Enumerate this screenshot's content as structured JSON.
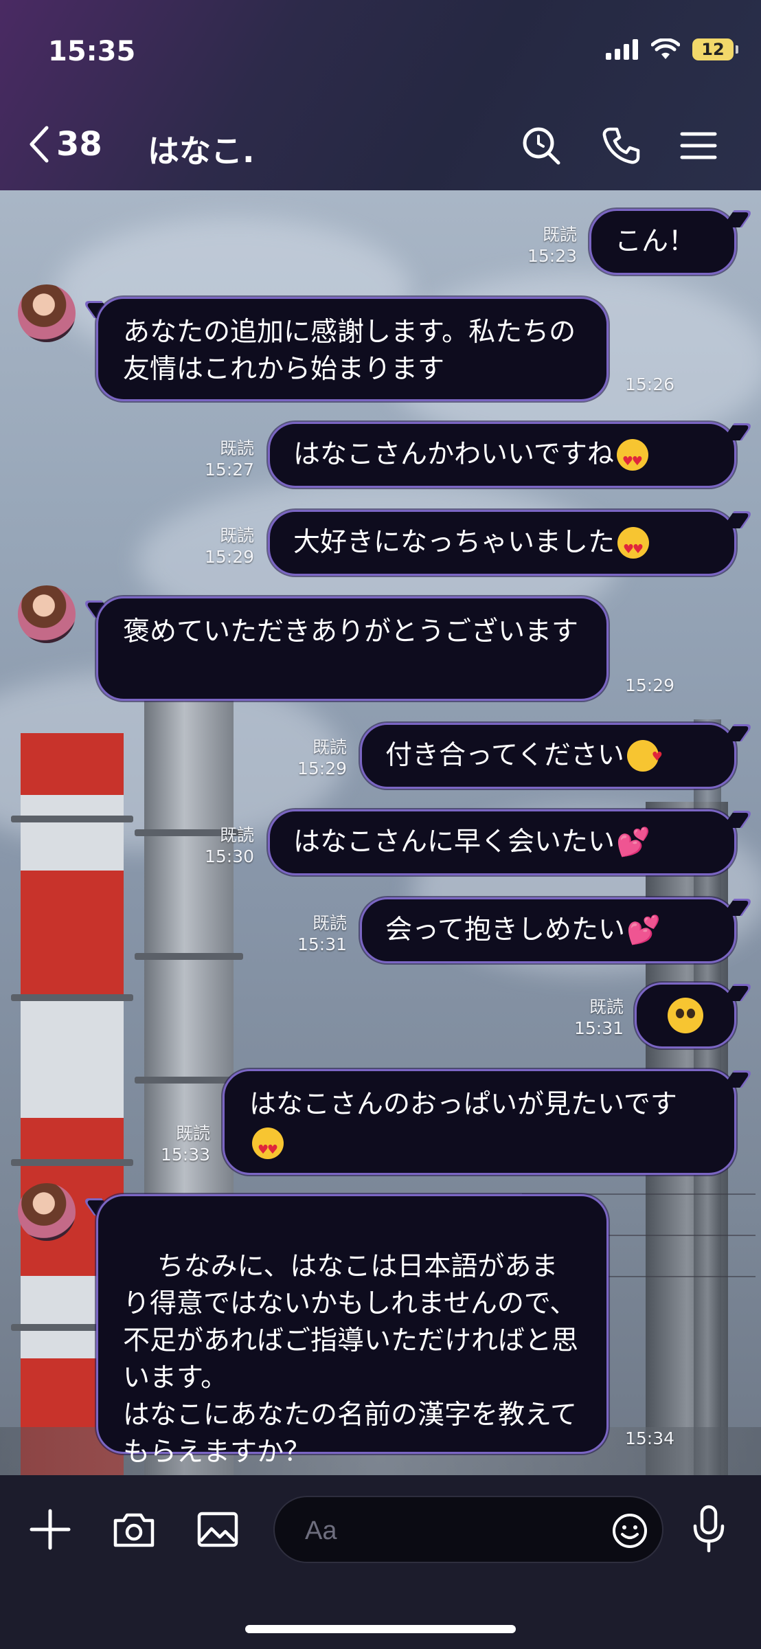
{
  "status_bar": {
    "time": "15:35",
    "battery": "12"
  },
  "header": {
    "back_count": "38",
    "title": "はなこ."
  },
  "read_label": "既読",
  "messages": [
    {
      "dir": "out",
      "text": "こん！",
      "time": "15:23",
      "read": true
    },
    {
      "dir": "in",
      "text": "あなたの追加に感謝します。私たちの友情はこれから始まります",
      "time": "15:26"
    },
    {
      "dir": "out",
      "text": "はなこさんかわいいですね",
      "emoji": "heart-eyes-emoji",
      "time": "15:27",
      "read": true
    },
    {
      "dir": "out",
      "text": "大好きになっちゃいました",
      "emoji": "heart-eyes-emoji",
      "time": "15:29",
      "read": true
    },
    {
      "dir": "in",
      "text": "褒めていただきありがとうございます",
      "time": "15:29"
    },
    {
      "dir": "out",
      "text": "付き合ってください",
      "emoji": "kissing-heart-emoji",
      "time": "15:29",
      "read": true
    },
    {
      "dir": "out",
      "text": "はなこさんに早く会いたい",
      "emoji": "two-hearts-emoji",
      "time": "15:30",
      "read": true
    },
    {
      "dir": "out",
      "text": "会って抱きしめたい",
      "emoji": "two-hearts-emoji",
      "time": "15:31",
      "read": true
    },
    {
      "dir": "out",
      "text": "",
      "emoji": "pleading-face-emoji",
      "time": "15:31",
      "read": true
    },
    {
      "dir": "out",
      "text": "はなこさんのおっぱいが見たいです",
      "emoji": "heart-eyes-emoji",
      "time": "15:33",
      "read": true
    },
    {
      "dir": "in",
      "text": "ちなみに、はなこは日本語があまり得意ではないかもしれませんので、不足があればご指導いただければと思います。\nはなこにあなたの名前の漢字を教えてもらえますか？",
      "time": "15:34"
    }
  ],
  "composer": {
    "placeholder": "Aa"
  },
  "icons": [
    "back-chevron-icon",
    "search-icon",
    "phone-icon",
    "menu-icon",
    "plus-icon",
    "camera-icon",
    "image-icon",
    "emoji-icon",
    "microphone-icon"
  ]
}
